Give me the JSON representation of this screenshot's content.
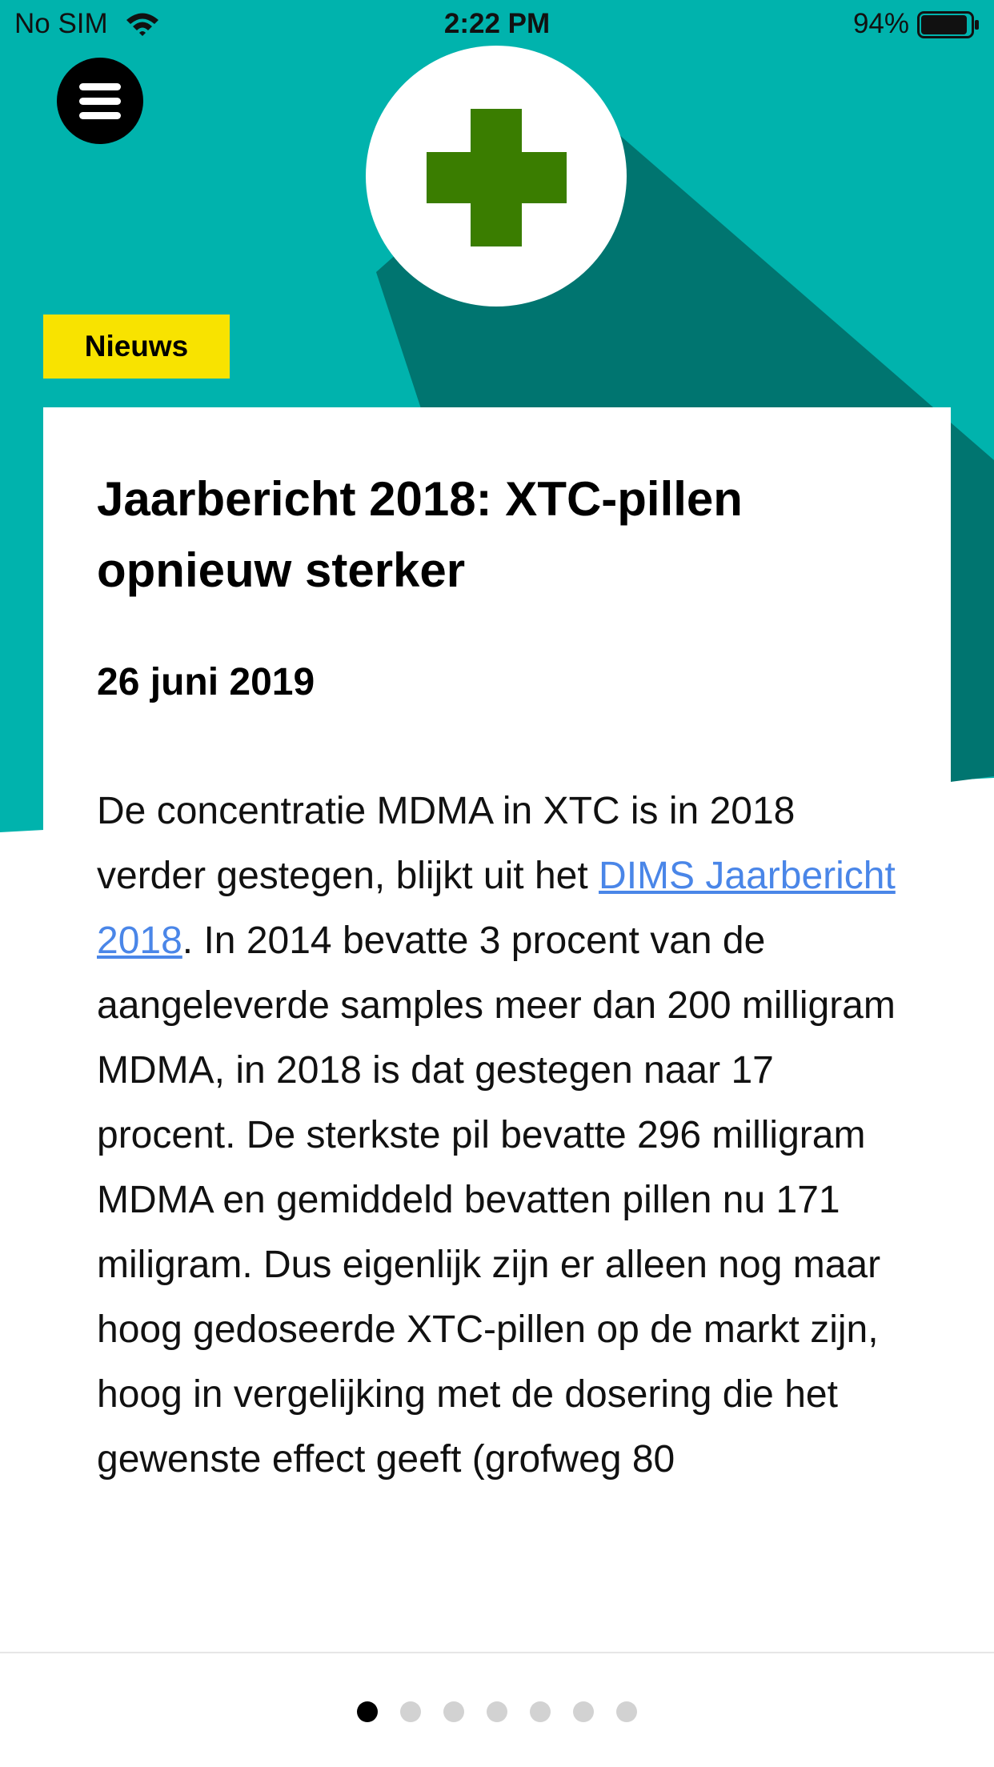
{
  "status_bar": {
    "carrier": "No SIM",
    "time": "2:22 PM",
    "battery": "94%",
    "battery_level": 0.94
  },
  "header": {
    "menu_icon": "hamburger-menu-icon",
    "logo_icon": "green-cross-icon",
    "colors": {
      "teal": "#00b3ad",
      "teal_shadow": "#007570",
      "cross_green": "#3a7d00",
      "tag_yellow": "#f8e300"
    }
  },
  "article": {
    "category": "Nieuws",
    "title": "Jaarbericht 2018: XTC-pillen opnieuw sterker",
    "date": "26 juni 2019",
    "body_before_link": "De concentratie MDMA in XTC is in 2018 verder gestegen, blijkt uit het ",
    "link_text": "DIMS Jaarbericht 2018",
    "body_after_link": ". In 2014 bevatte 3 procent van de aangeleverde samples meer dan 200 milligram MDMA, in 2018 is dat gestegen naar 17 procent. De sterkste pil bevatte 296 milligram MDMA en gemiddeld bevatten pillen nu 171 miligram. Dus eigenlijk zijn er alleen nog maar hoog gedoseerde XTC-pillen op de markt zijn, hoog in vergelijking met de dosering die het gewenste effect geeft (grofweg 80"
  },
  "pager": {
    "total": 7,
    "active_index": 0
  }
}
